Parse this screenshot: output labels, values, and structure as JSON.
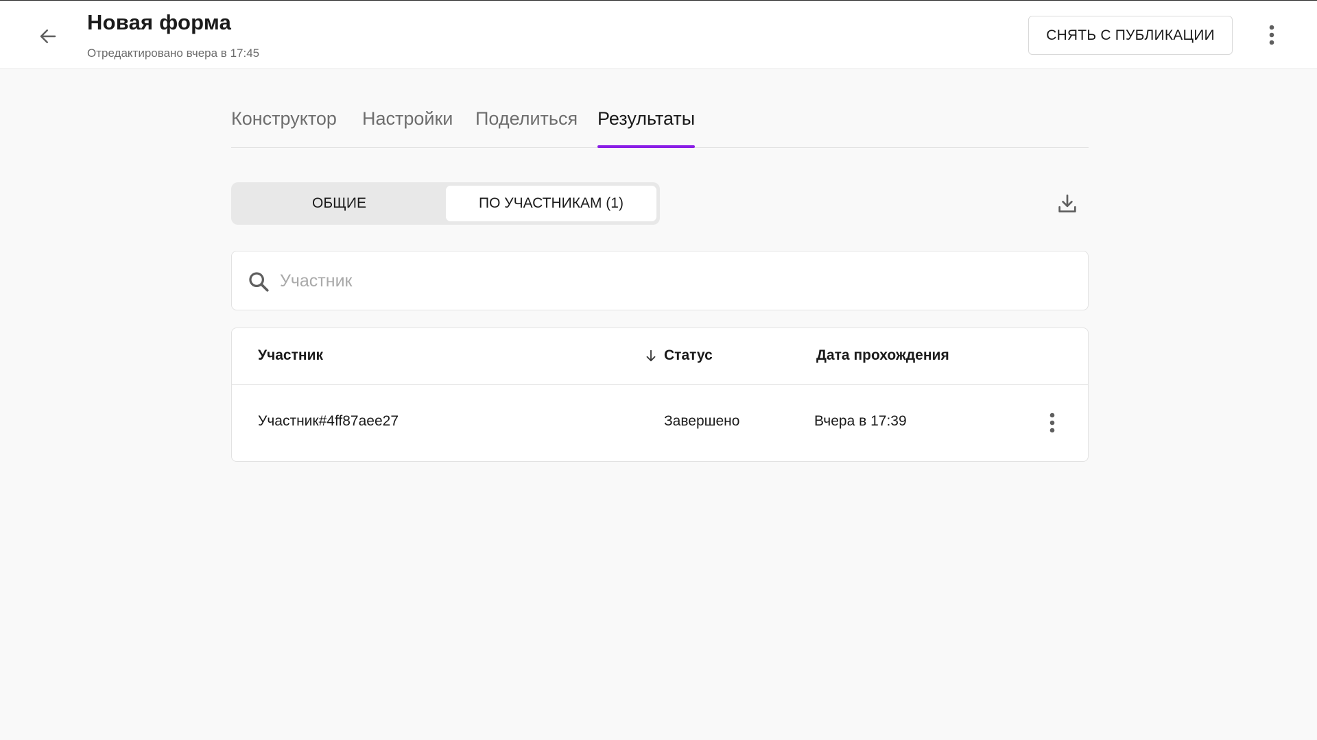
{
  "header": {
    "title": "Новая форма",
    "edited_text": "Отредактировано вчера в 17:45",
    "unpublish_label": "СНЯТЬ С ПУБЛИКАЦИИ",
    "back_icon": "arrow-left-icon",
    "more_icon": "more-vertical-icon"
  },
  "tabs": [
    {
      "label": "Конструктор",
      "active": false
    },
    {
      "label": "Настройки",
      "active": false
    },
    {
      "label": "Поделиться",
      "active": false
    },
    {
      "label": "Результаты",
      "active": true
    }
  ],
  "accent_color": "#8a1ee6",
  "view_switch": {
    "general_label": "ОБЩИЕ",
    "participants_label": "ПО УЧАСТНИКАМ (1)",
    "selected": "participants"
  },
  "download_icon": "download-icon",
  "search": {
    "placeholder": "Участник",
    "value": "",
    "icon": "search-icon"
  },
  "table": {
    "columns": {
      "name": "Участник",
      "status": "Статус",
      "date": "Дата прохождения"
    },
    "sort_icon": "arrow-down-icon",
    "rows": [
      {
        "name": "Участник#4ff87aee27",
        "status": "Завершено",
        "date": "Вчера в 17:39"
      }
    ]
  }
}
